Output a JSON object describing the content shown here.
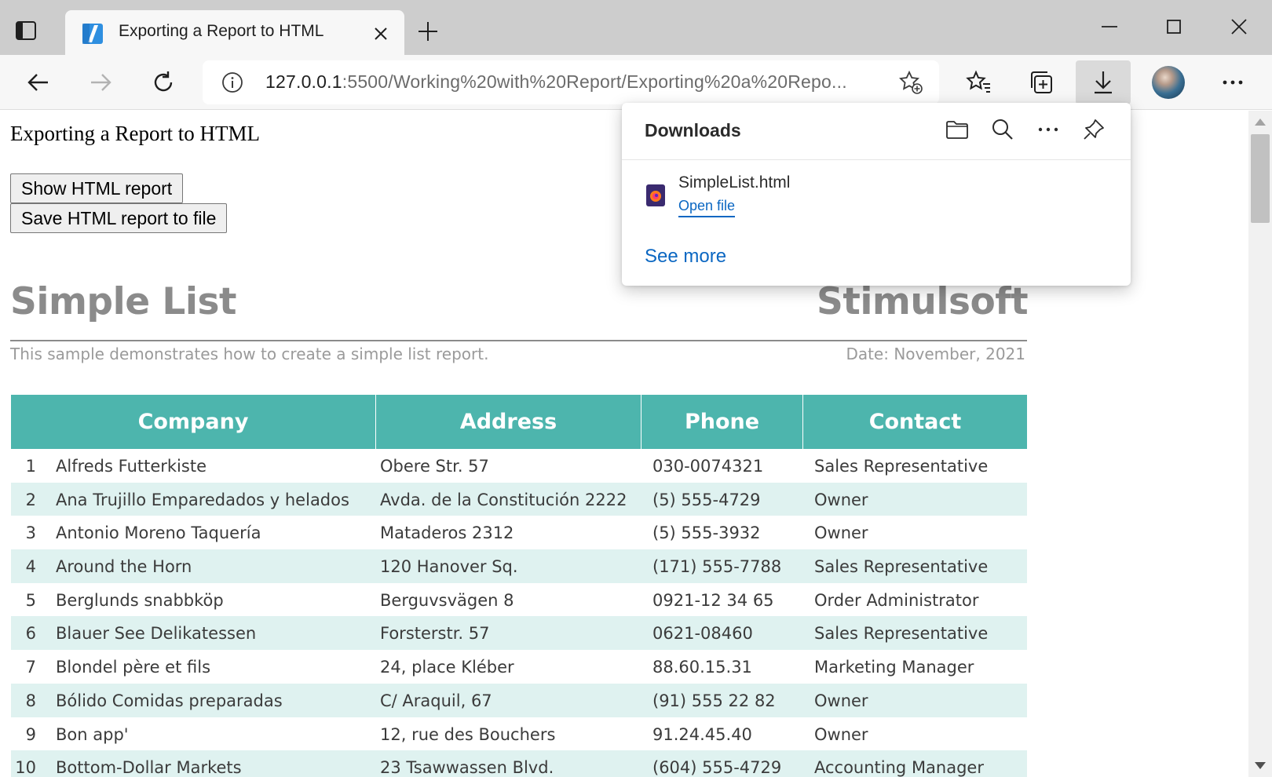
{
  "browser": {
    "tab_title": "Exporting a Report to HTML",
    "address_host": "127.0.0.1",
    "address_path": ":5500/Working%20with%20Report/Exporting%20a%20Repo...",
    "accent_color": "#0b67c2"
  },
  "page": {
    "heading": "Exporting a Report to HTML",
    "buttons": {
      "show": "Show HTML report",
      "save": "Save HTML report to file"
    }
  },
  "report": {
    "title": "Simple List",
    "brand": "Stimulsoft",
    "subtitle": "This sample demonstrates how to create a simple list report.",
    "date": "Date: November, 2021",
    "header_color": "#4db5ad",
    "stripe_color": "#dff2f0",
    "columns": [
      "Company",
      "Address",
      "Phone",
      "Contact"
    ],
    "rows": [
      {
        "num": "1",
        "company": "Alfreds Futterkiste",
        "address": "Obere Str. 57",
        "phone": "030-0074321",
        "contact": "Sales Representative"
      },
      {
        "num": "2",
        "company": "Ana Trujillo Emparedados y helados",
        "address": "Avda. de la Constitución 2222",
        "phone": "(5) 555-4729",
        "contact": "Owner"
      },
      {
        "num": "3",
        "company": "Antonio Moreno Taquería",
        "address": "Mataderos  2312",
        "phone": "(5) 555-3932",
        "contact": "Owner"
      },
      {
        "num": "4",
        "company": "Around the Horn",
        "address": "120 Hanover Sq.",
        "phone": "(171) 555-7788",
        "contact": "Sales Representative"
      },
      {
        "num": "5",
        "company": "Berglunds snabbköp",
        "address": "Berguvsvägen  8",
        "phone": "0921-12 34 65",
        "contact": "Order Administrator"
      },
      {
        "num": "6",
        "company": "Blauer See Delikatessen",
        "address": "Forsterstr. 57",
        "phone": "0621-08460",
        "contact": "Sales Representative"
      },
      {
        "num": "7",
        "company": "Blondel père et fils",
        "address": "24, place Kléber",
        "phone": "88.60.15.31",
        "contact": "Marketing Manager"
      },
      {
        "num": "8",
        "company": "Bólido Comidas preparadas",
        "address": "C/ Araquil, 67",
        "phone": "(91) 555 22 82",
        "contact": "Owner"
      },
      {
        "num": "9",
        "company": "Bon app'",
        "address": "12, rue des Bouchers",
        "phone": "91.24.45.40",
        "contact": "Owner"
      },
      {
        "num": "10",
        "company": "Bottom-Dollar Markets",
        "address": "23 Tsawwassen Blvd.",
        "phone": "(604) 555-4729",
        "contact": "Accounting Manager"
      }
    ]
  },
  "downloads": {
    "title": "Downloads",
    "file_name": "SimpleList.html",
    "open_label": "Open file",
    "see_more": "See more"
  }
}
